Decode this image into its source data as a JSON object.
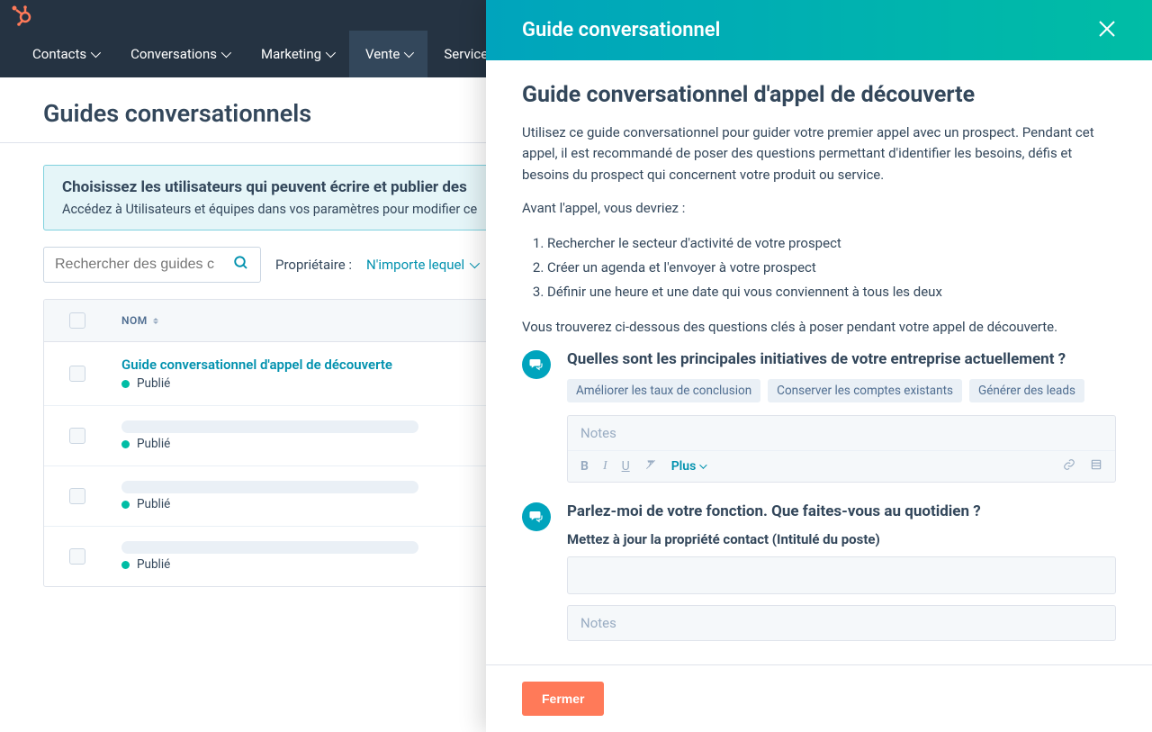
{
  "nav": {
    "items": [
      "Contacts",
      "Conversations",
      "Marketing",
      "Vente",
      "Service client"
    ],
    "activeIndex": 3
  },
  "page": {
    "title": "Guides conversationnels"
  },
  "notice": {
    "title": "Choisissez les utilisateurs qui peuvent écrire et publier des",
    "body": "Accédez à Utilisateurs et équipes dans vos paramètres pour modifier ce"
  },
  "filters": {
    "searchPlaceholder": "Rechercher des guides c",
    "ownerLabel": "Propriétaire :",
    "ownerValue": "N'importe lequel"
  },
  "table": {
    "nameHeader": "NOM",
    "rows": [
      {
        "title": "Guide conversationnel d'appel de découverte",
        "status": "Publié",
        "placeholder": false
      },
      {
        "title": "",
        "status": "Publié",
        "placeholder": true
      },
      {
        "title": "",
        "status": "Publié",
        "placeholder": true
      },
      {
        "title": "",
        "status": "Publié",
        "placeholder": true
      }
    ]
  },
  "panel": {
    "headerTitle": "Guide conversationnel",
    "h1": "Guide conversationnel d'appel de découverte",
    "intro": "Utilisez ce guide conversationnel pour guider votre premier appel avec un prospect. Pendant cet appel, il est recommandé de poser des questions permettant d'identifier les besoins, défis et besoins du prospect qui concernent votre produit ou service.",
    "beforeLabel": "Avant l'appel, vous devriez :",
    "beforeList": [
      "Rechercher le secteur d'activité de votre prospect",
      "Créer un agenda et l'envoyer à votre prospect",
      "Définir une heure et une date qui vous conviennent à tous les deux"
    ],
    "belowText": "Vous trouverez ci-dessous des questions clés à poser pendant votre appel de découverte.",
    "q1": {
      "title": "Quelles sont les principales initiatives de votre entreprise actuellement ?",
      "chips": [
        "Améliorer les taux de conclusion",
        "Conserver les comptes existants",
        "Générer des leads"
      ],
      "notesPlaceholder": "Notes",
      "plusLabel": "Plus"
    },
    "q2": {
      "title": "Parlez-moi de votre fonction. Que faites-vous au quotidien ?",
      "subtitle": "Mettez à jour la propriété contact (Intitulé du poste)",
      "notesPlaceholder": "Notes"
    },
    "closeButton": "Fermer"
  }
}
